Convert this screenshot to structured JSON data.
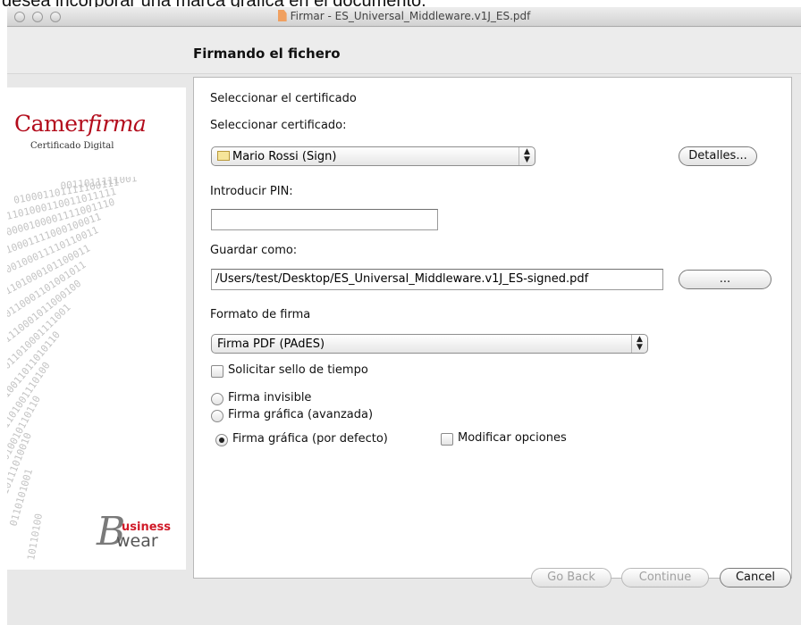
{
  "background_caption": "desea incorporar una marca gráfica en el documento.",
  "window": {
    "title": "Firmar - ES_Universal_Middleware.v1J_ES.pdf",
    "step_title": "Firmando el fichero"
  },
  "sidebar": {
    "logo_text_1": "Camer",
    "logo_text_2": "firma",
    "logo_subtitle": "Certificado Digital",
    "brand_mark": "business wear"
  },
  "form": {
    "section_title": "Seleccionar el certificado",
    "cert_label": "Seleccionar certificado:",
    "cert_value": "Mario Rossi (Sign)",
    "details_button": "Detalles...",
    "pin_label": "Introducir PIN:",
    "pin_value": "",
    "save_label": "Guardar como:",
    "save_path": "/Users/test/Desktop/ES_Universal_Middleware.v1J_ES-signed.pdf",
    "browse_button": "...",
    "format_label": "Formato de firma",
    "format_value": "Firma PDF (PAdES)",
    "timestamp_label": "Solicitar sello de tiempo",
    "timestamp_checked": false,
    "radio_invisible": "Firma invisible",
    "radio_advanced": "Firma gráfica (avanzada)",
    "radio_default": "Firma gráfica (por defecto)",
    "selected_radio": "default",
    "modify_label": "Modificar opciones",
    "modify_checked": false
  },
  "footer": {
    "back_button": "Go Back",
    "continue_button": "Continue",
    "cancel_button": "Cancel"
  },
  "colors": {
    "brand_red": "#b30c1c",
    "window_bg": "#e8e8e8"
  }
}
